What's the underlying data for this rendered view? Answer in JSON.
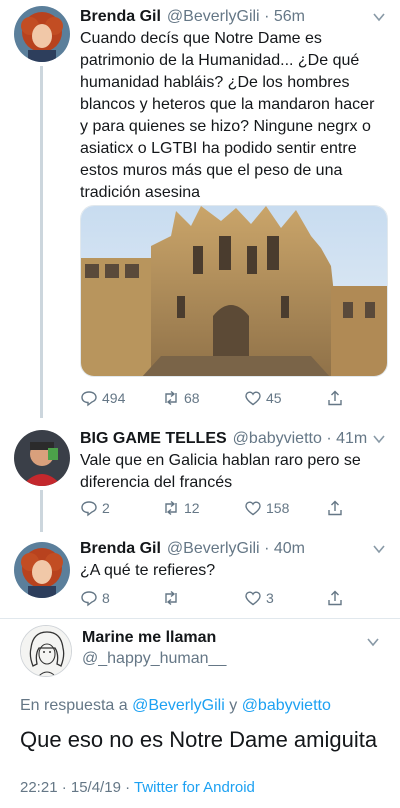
{
  "tweets": [
    {
      "name": "Brenda Gil",
      "handle": "@BeverlyGili",
      "sep": "·",
      "time": "56m",
      "text": "Cuando decís que Notre Dame es patrimonio de la Humanidad... ¿De qué humanidad habláis? ¿De los hombres blancos y heteros que la mandaron hacer y para quienes se hizo? Ningune negrx o asiaticx o LGTBI ha podido sentir entre estos muros más que el peso de una tradición asesina",
      "replies": "494",
      "retweets": "68",
      "likes": "45"
    },
    {
      "name": "BIG GAME TELLES",
      "handle": "@babyvietto",
      "sep": "·",
      "time": "41m",
      "text": "Vale que en Galicia hablan raro pero se diferencia del francés",
      "replies": "2",
      "retweets": "12",
      "likes": "158"
    },
    {
      "name": "Brenda Gil",
      "handle": "@BeverlyGili",
      "sep": "·",
      "time": "40m",
      "text": "¿A qué te refieres?",
      "replies": "8",
      "retweets": "",
      "likes": "3"
    }
  ],
  "main": {
    "name": "Marine me llaman",
    "handle": "@_happy_human__",
    "reply_prefix": "En respuesta a",
    "reply_user1": "@BeverlyGili",
    "reply_and": "y",
    "reply_user2": "@babyvietto",
    "text": "Que eso no es Notre Dame amiguita",
    "date": "22:21 · 15/4/19 ·",
    "source": "Twitter for Android"
  },
  "colors": {
    "accent": "#1da1f2",
    "secondary_text": "#657786",
    "divider": "#e1e8ed"
  }
}
